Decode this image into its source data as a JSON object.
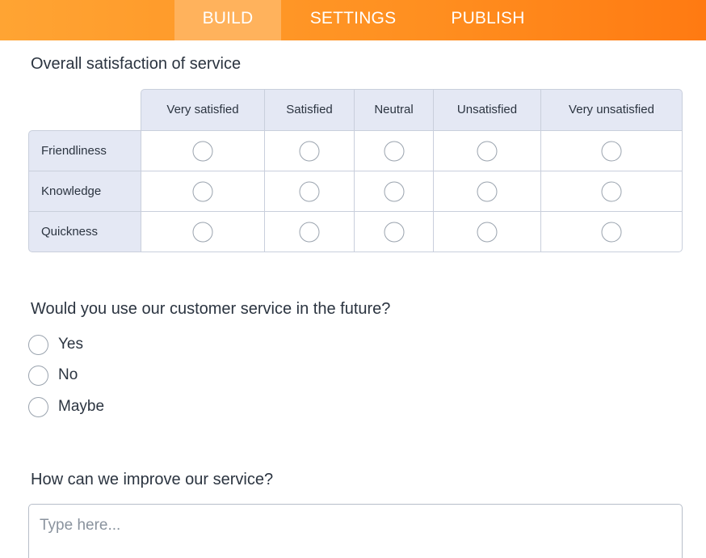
{
  "tabs": [
    {
      "label": "BUILD",
      "active": true
    },
    {
      "label": "SETTINGS",
      "active": false
    },
    {
      "label": "PUBLISH",
      "active": false
    }
  ],
  "accent_color": "#ff8f20",
  "questions": {
    "q1": {
      "title": "Overall satisfaction of service",
      "columns": [
        "Very satisfied",
        "Satisfied",
        "Neutral",
        "Unsatisfied",
        "Very unsatisfied"
      ],
      "rows": [
        "Friendliness",
        "Knowledge",
        "Quickness"
      ]
    },
    "q2": {
      "title": "Would you use our customer service in the future?",
      "options": [
        "Yes",
        "No",
        "Maybe"
      ]
    },
    "q3": {
      "title": "How can we improve our service?",
      "placeholder": "Type here..."
    }
  }
}
